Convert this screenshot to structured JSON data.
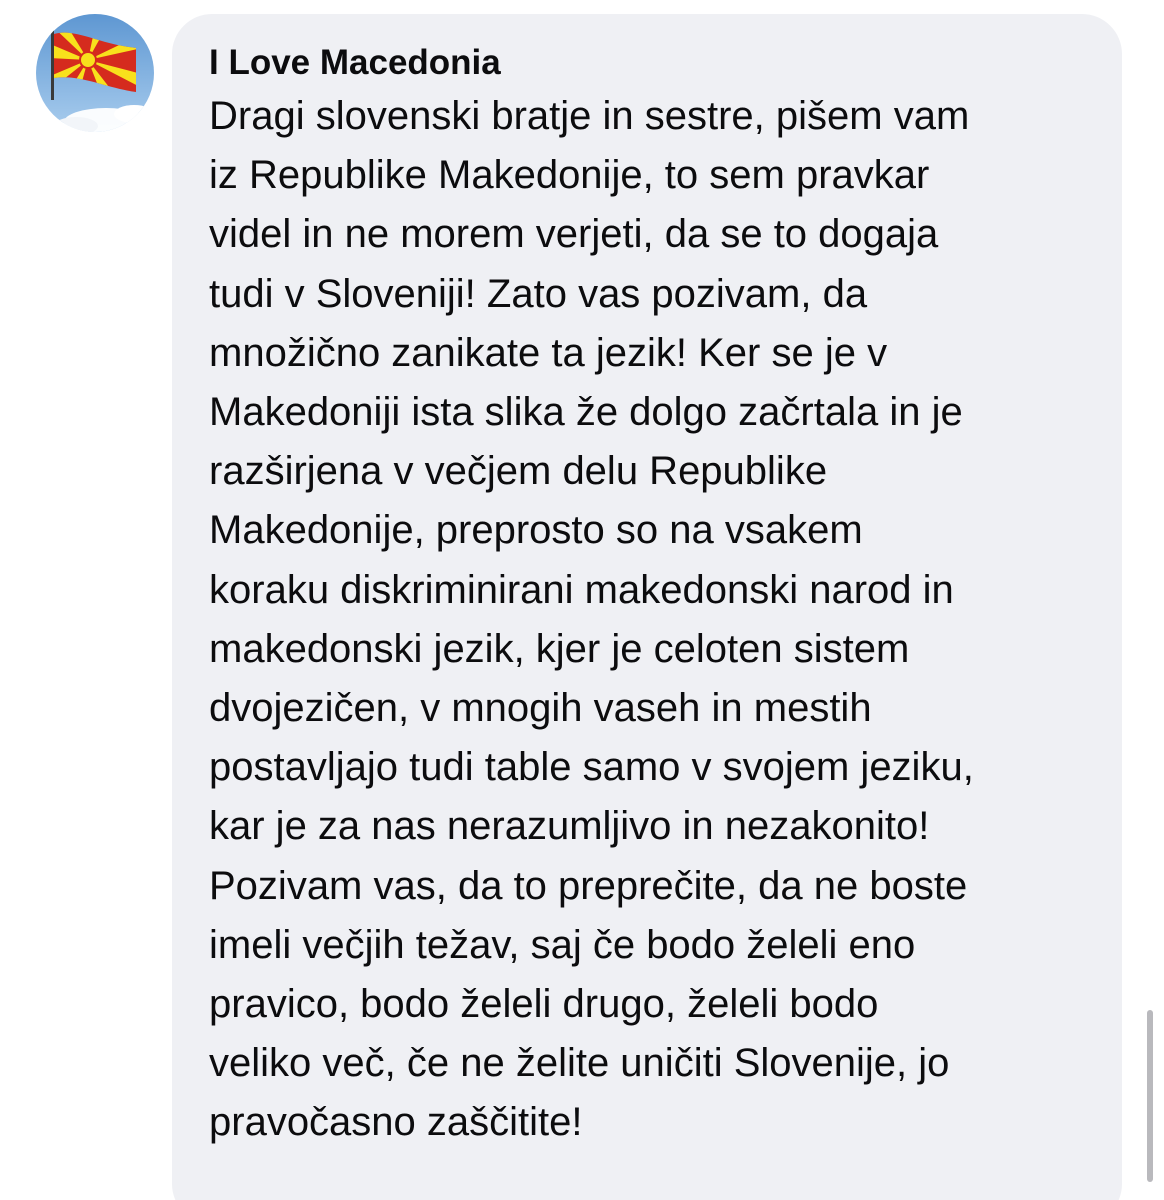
{
  "comment": {
    "author": "I Love Macedonia",
    "text_lines": [
      "Dragi slovenski bratje in sestre, pišem vam",
      "iz Republike Makedonije, to sem pravkar",
      "videl in ne morem verjeti, da se to dogaja",
      "tudi v Sloveniji! Zato vas pozivam, da",
      "množično zanikate ta jezik! Ker se je v",
      "Makedoniji ista slika že dolgo začrtala in je",
      "razširjena v večjem delu Republike",
      "Makedonije, preprosto so na vsakem",
      "koraku diskriminirani makedonski narod in",
      "makedonski jezik, kjer je celoten sistem",
      "dvojezičen, v mnogih vaseh in mestih",
      "postavljajo tudi table samo v svojem jeziku,",
      "kar je za nas nerazumljivo in nezakonito!",
      "Pozivam vas, da to preprečite, da ne boste",
      "imeli večjih težav, saj če bodo želeli eno",
      "pravico, bodo želeli drugo, želeli bodo",
      "veliko več, če ne želite uničiti Slovenije, jo",
      "pravočasno zaščitite!"
    ]
  },
  "avatar": {
    "icon": "macedonian-flag-avatar",
    "sky_color": "#7db0de",
    "flag_red": "#d52b1e",
    "flag_yellow": "#f8e11c"
  },
  "colors": {
    "bubble_background": "#eff0f4",
    "text": "#0c0c0e",
    "scrollbar": "#b9b9bd"
  }
}
